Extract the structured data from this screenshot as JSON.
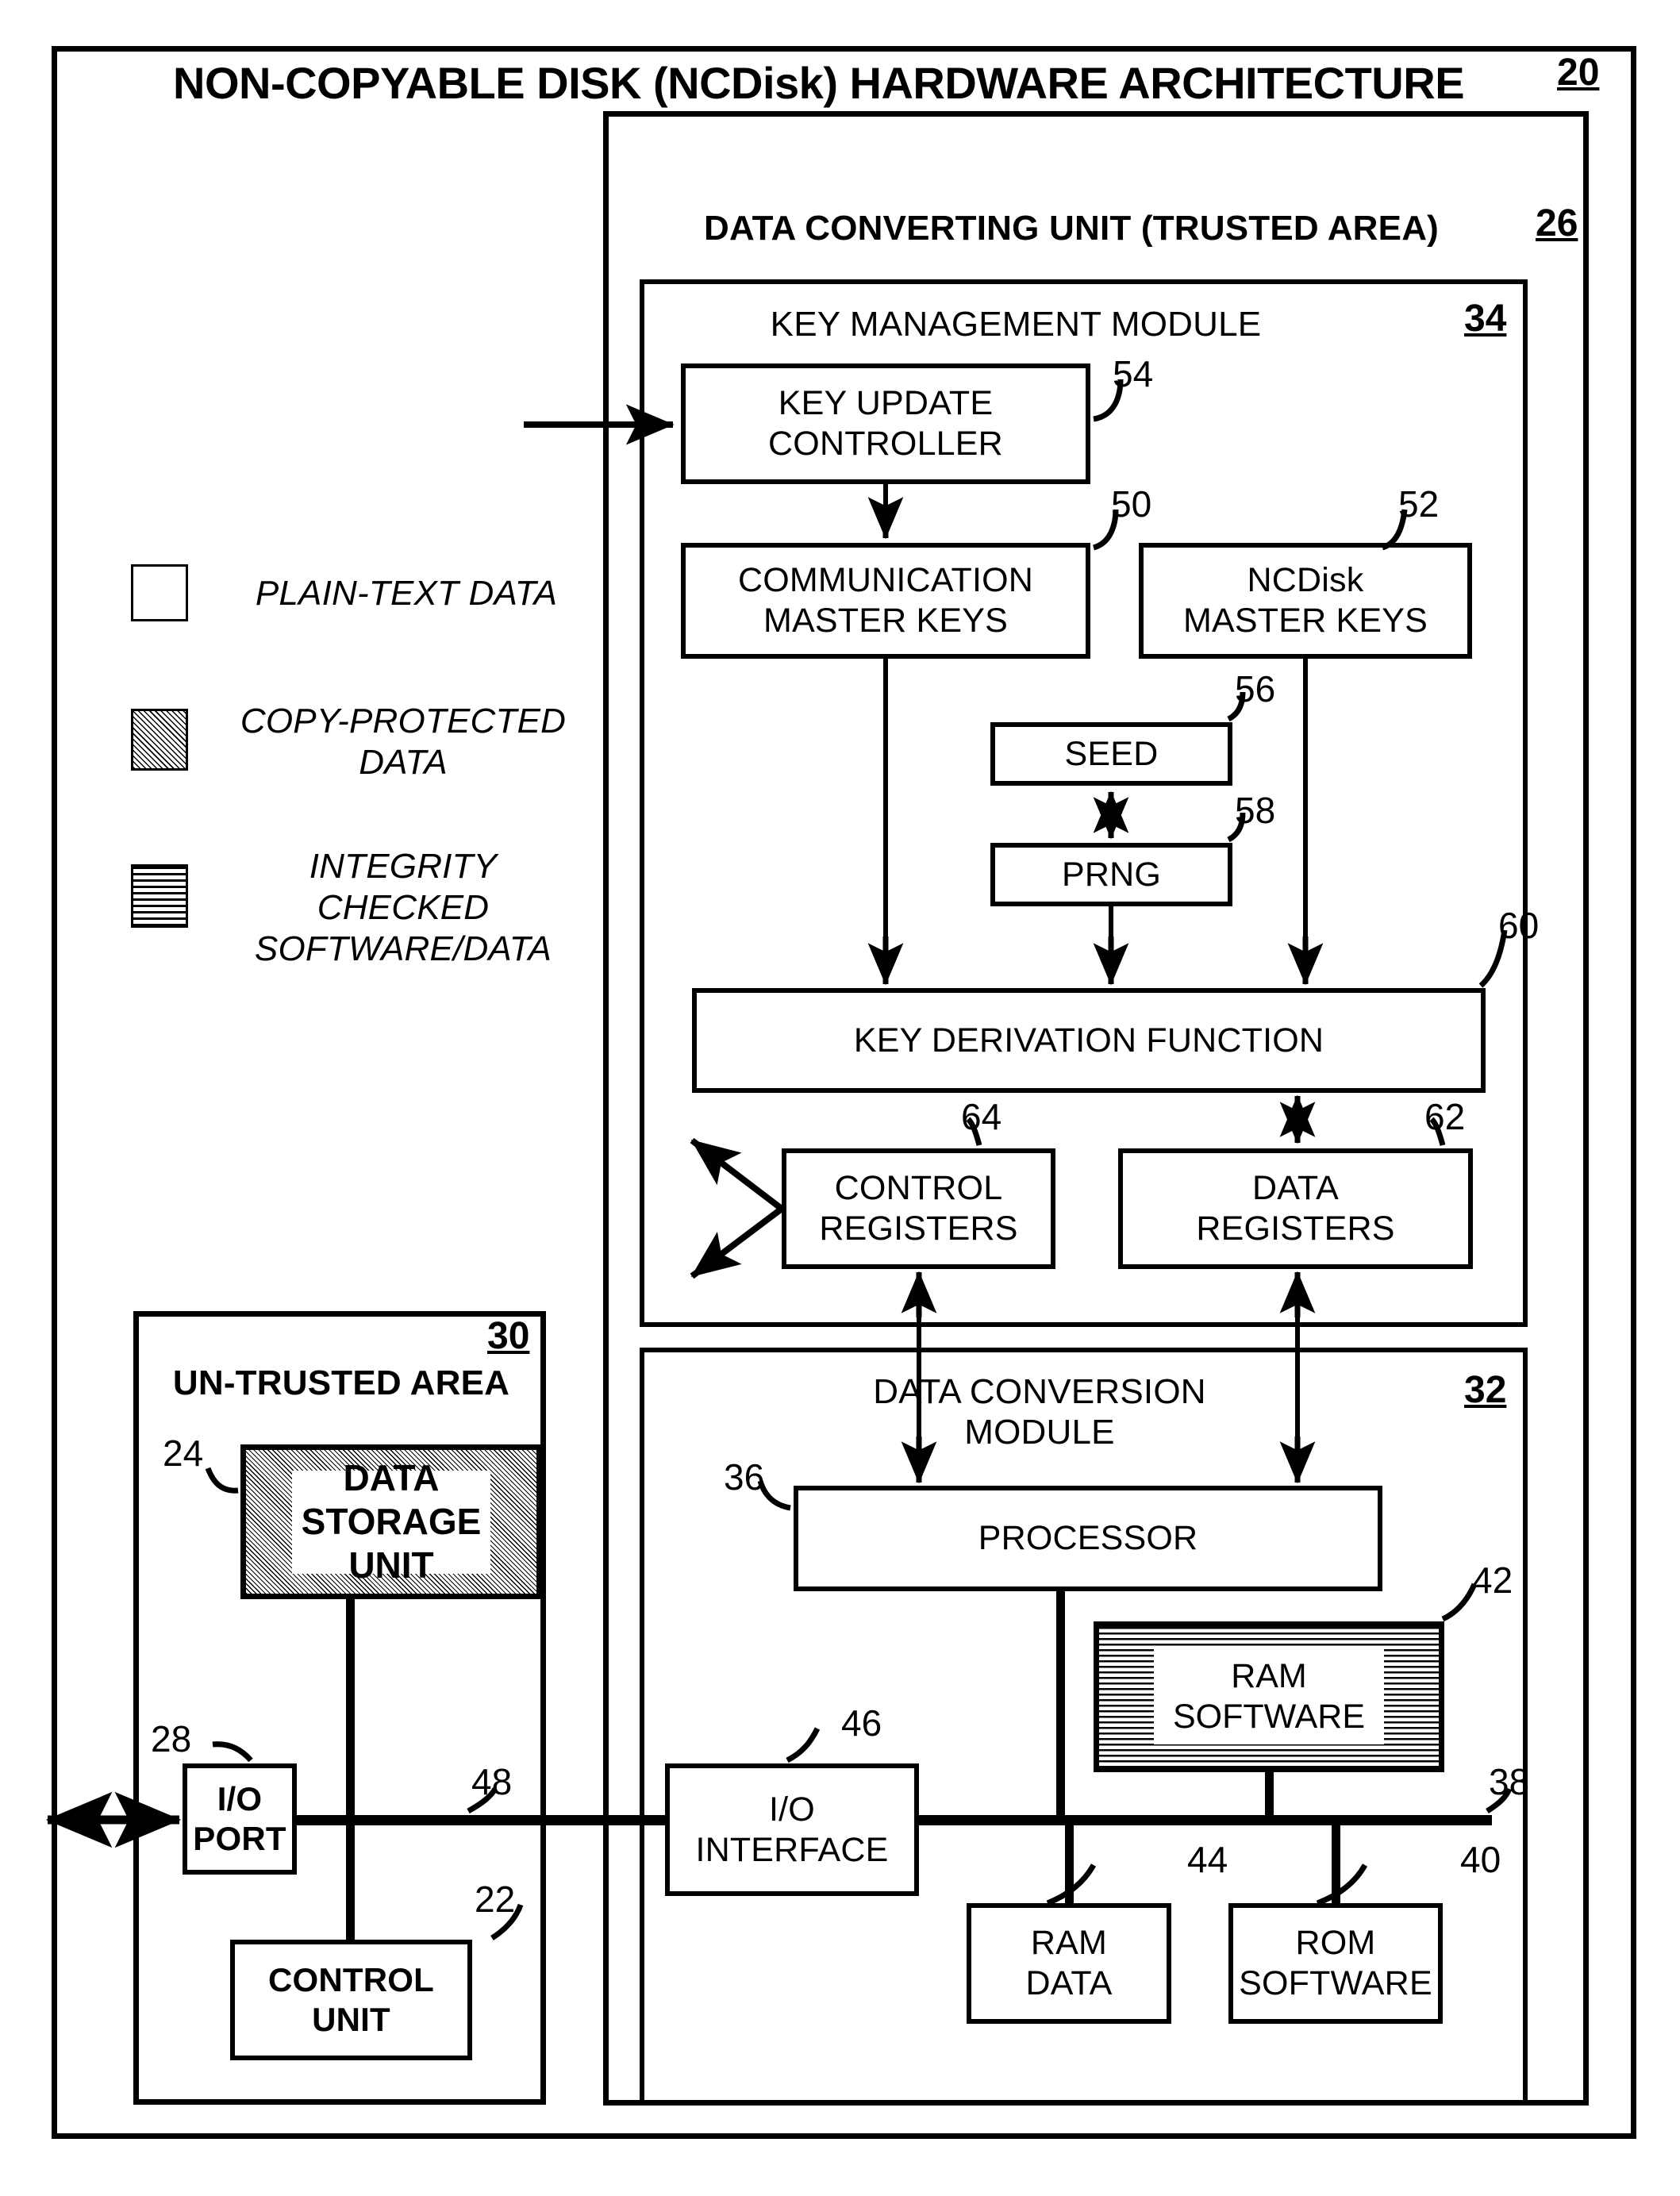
{
  "figure": {
    "title": "NON-COPYABLE DISK (NCDisk) HARDWARE ARCHITECTURE",
    "title_ref": "20"
  },
  "legend": {
    "items": [
      {
        "label": "PLAIN-TEXT DATA",
        "swatch": "plain-white-square"
      },
      {
        "label": "COPY-PROTECTED\nDATA",
        "swatch": "diagonal-hatch-square"
      },
      {
        "label": "INTEGRITY\nCHECKED\nSOFTWARE/DATA",
        "swatch": "horizontal-lines-square"
      }
    ]
  },
  "trusted_area": {
    "caption": "DATA CONVERTING UNIT (TRUSTED AREA)",
    "ref": "26"
  },
  "key_management_module": {
    "caption": "KEY MANAGEMENT MODULE",
    "ref": "34",
    "blocks": [
      {
        "label": "KEY UPDATE\nCONTROLLER",
        "ref": "54"
      },
      {
        "label": "COMMUNICATION\nMASTER KEYS",
        "ref": "50"
      },
      {
        "label": "NCDisk\nMASTER KEYS",
        "ref": "52"
      },
      {
        "label": "SEED",
        "ref": "56"
      },
      {
        "label": "PRNG",
        "ref": "58"
      },
      {
        "label": "KEY DERIVATION FUNCTION",
        "ref": "60"
      },
      {
        "label": "CONTROL\nREGISTERS",
        "ref": "64"
      },
      {
        "label": "DATA\nREGISTERS",
        "ref": "62"
      }
    ]
  },
  "data_conversion_module": {
    "caption": "DATA CONVERSION\nMODULE",
    "ref": "32",
    "blocks": [
      {
        "label": "PROCESSOR",
        "ref": "36"
      },
      {
        "label": "RAM\nSOFTWARE",
        "ref": "42"
      },
      {
        "label": "I/O\nINTERFACE",
        "ref": "46"
      },
      {
        "label": "RAM\nDATA",
        "ref": "44"
      },
      {
        "label": "ROM\nSOFTWARE",
        "ref": "40"
      }
    ],
    "bus_ref": "38"
  },
  "untrusted_area": {
    "caption": "UN-TRUSTED AREA",
    "ref": "30",
    "blocks": [
      {
        "label": "DATA\nSTORAGE\nUNIT",
        "ref": "24"
      },
      {
        "label": "I/O\nPORT",
        "ref": "28"
      },
      {
        "label": "CONTROL\nUNIT",
        "ref": "22"
      }
    ],
    "bus_ref": "48"
  },
  "colors": {
    "ink": "#000000",
    "paper": "#ffffff"
  }
}
